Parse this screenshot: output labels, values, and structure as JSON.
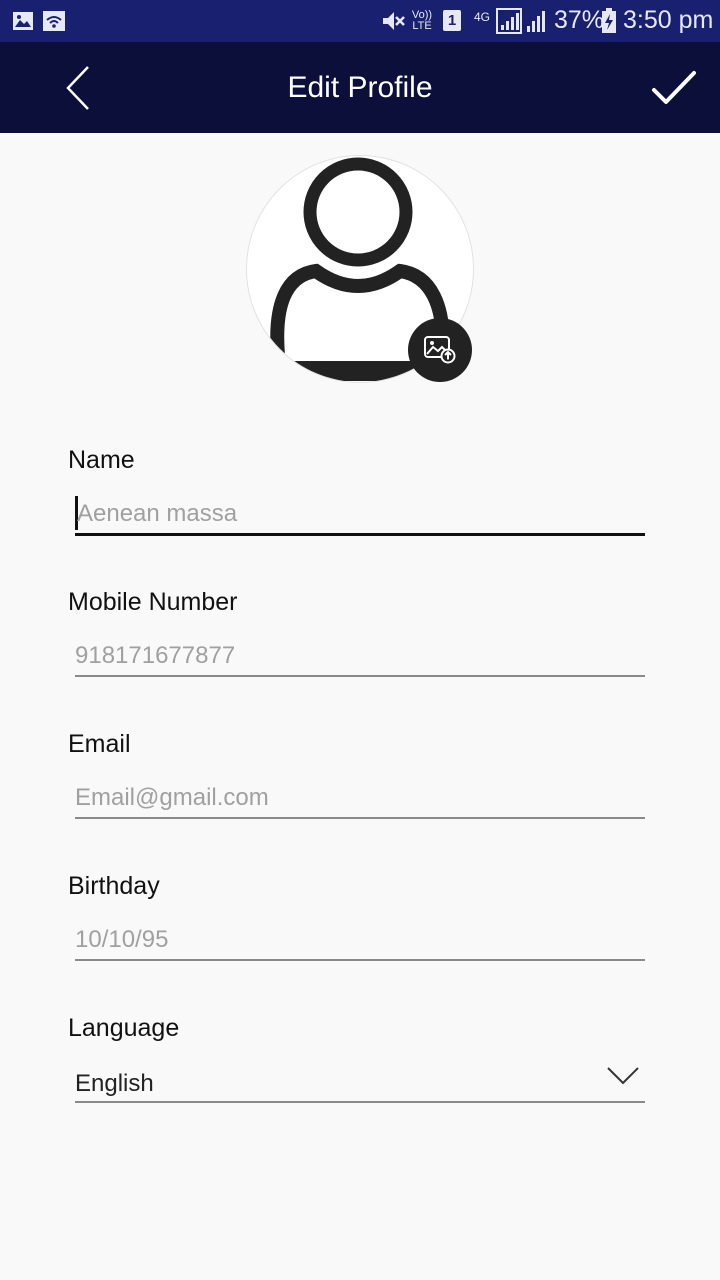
{
  "status_bar": {
    "battery": "37%",
    "time": "3:50 pm",
    "network_type": "4G",
    "volte": "Vo)) LTE",
    "sim_slot": "1"
  },
  "app_bar": {
    "title": "Edit Profile",
    "back_icon": "chevron-left-icon",
    "done_icon": "checkmark-icon"
  },
  "avatar": {
    "icon": "user-placeholder-icon",
    "upload_icon": "image-upload-icon"
  },
  "form": {
    "name": {
      "label": "Name",
      "placeholder": "Aenean massa",
      "value": ""
    },
    "mobile": {
      "label": "Mobile Number",
      "placeholder": "918171677877",
      "value": ""
    },
    "email": {
      "label": "Email",
      "placeholder": "Email@gmail.com",
      "value": ""
    },
    "birthday": {
      "label": "Birthday",
      "placeholder": "10/10/95",
      "value": ""
    },
    "language": {
      "label": "Language",
      "value": "English"
    }
  },
  "colors": {
    "status_bar": "#1a2070",
    "app_bar": "#0b0f3a",
    "background": "#f9f9f9"
  }
}
